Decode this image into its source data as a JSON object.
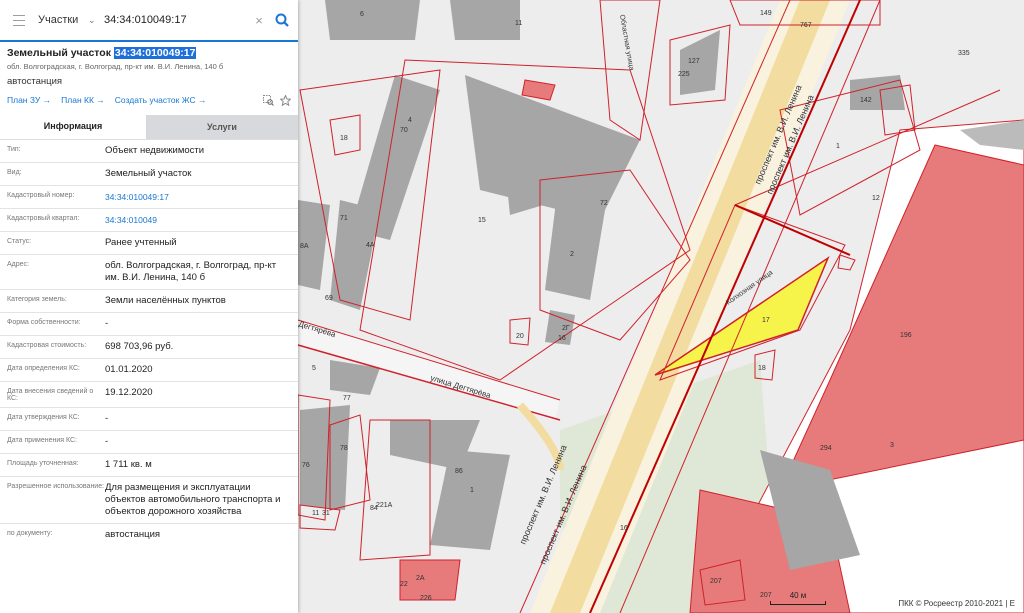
{
  "search": {
    "type_label": "Участки",
    "value": "34:34:010049:17"
  },
  "object": {
    "title_prefix": "Земельный участок",
    "cad_number": "34:34:010049:17",
    "address_short": "обл. Волгоградская, г. Волгоград, пр-кт им. В.И. Ленина, 140 б",
    "use": "автостанция"
  },
  "links": [
    "План ЗУ →",
    "План КК →",
    "Создать участок ЖС →"
  ],
  "tabs": {
    "info": "Информация",
    "services": "Услуги"
  },
  "rows": [
    {
      "label": "Тип:",
      "value": "Объект недвижимости",
      "link": false
    },
    {
      "label": "Вид:",
      "value": "Земельный участок",
      "link": false
    },
    {
      "label": "Кадастровый номер:",
      "value": "34:34:010049:17",
      "link": true
    },
    {
      "label": "Кадастровый квартал:",
      "value": "34:34:010049",
      "link": true
    },
    {
      "label": "Статус:",
      "value": "Ранее учтенный",
      "link": false
    },
    {
      "label": "Адрес:",
      "value": "обл. Волгоградская, г. Волгоград, пр-кт им. В.И. Ленина, 140 б",
      "link": false
    },
    {
      "label": "Категория земель:",
      "value": "Земли населённых пунктов",
      "link": false
    },
    {
      "label": "Форма собственности:",
      "value": "-",
      "link": false
    },
    {
      "label": "Кадастровая стоимость:",
      "value": "698 703,96 руб.",
      "link": false
    },
    {
      "label": "Дата определения КС:",
      "value": "01.01.2020",
      "link": false
    },
    {
      "label": "Дата внесения сведений о КС:",
      "value": "19.12.2020",
      "link": false
    },
    {
      "label": "Дата утверждения КС:",
      "value": "-",
      "link": false
    },
    {
      "label": "Дата применения КС:",
      "value": "-",
      "link": false
    },
    {
      "label": "Площадь уточненная:",
      "value": "1 711 кв. м",
      "link": false
    },
    {
      "label": "Разрешенное использование:",
      "value": "Для размещения и эксплуатации объектов автомобильного транспорта и объектов дорожного хозяйства",
      "link": false
    },
    {
      "label": "по документу:",
      "value": "автостанция",
      "link": false
    }
  ],
  "map": {
    "streets": {
      "lenina_1": "проспект им. В.И. Ленина",
      "lenina_2": "проспект им. В.И. Ленина",
      "lenina_3": "проспект им. В.И. Ленина",
      "lenina_4": "проспект им. В.И. Ленина",
      "oblastnaya": "Областная улица",
      "kolkhoznaya": "Колхозная улица",
      "degtyareva_1": "улица Дегтярёва",
      "degtyareva_2": "Дегтярёва"
    },
    "numbers": [
      "6",
      "11",
      "149",
      "767",
      "335",
      "127",
      "225",
      "142",
      "1",
      "12",
      "4",
      "70",
      "18",
      "72",
      "2",
      "15",
      "71",
      "4А",
      "69",
      "8А",
      "17",
      "2Г",
      "20",
      "16",
      "18",
      "196",
      "5",
      "77",
      "294",
      "3",
      "76",
      "78",
      "86",
      "1",
      "31",
      "84",
      "221А",
      "11",
      "16",
      "22",
      "2А",
      "207",
      "207",
      "226"
    ],
    "scale": "40 м",
    "attribution": "ПКК © Росреестр 2010-2021 | Е",
    "colors": {
      "parcel_border": "#d0212b",
      "selected_fill": "#f6f44a",
      "building_fill": "#e77b7b",
      "building_gray": "#a6a6a6",
      "road": "#f2dca0"
    }
  }
}
